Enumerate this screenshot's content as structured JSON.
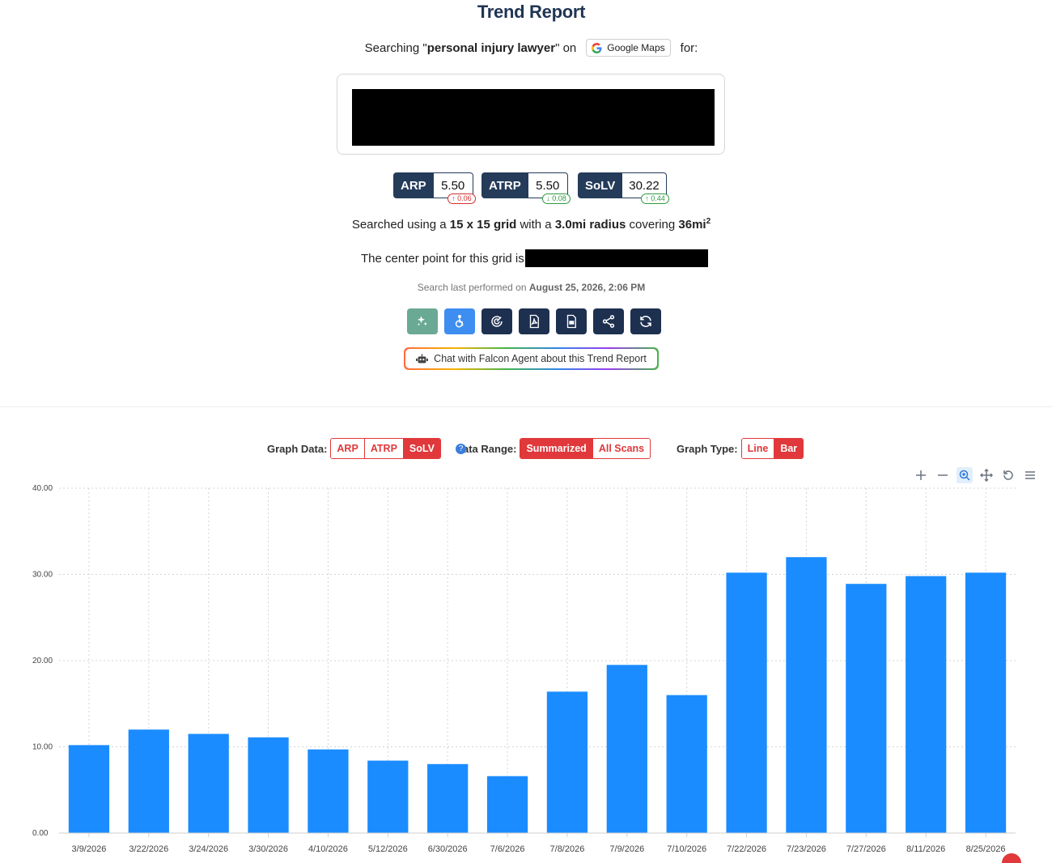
{
  "header": {
    "title": "Trend Report"
  },
  "search": {
    "prefix": "Searching \"",
    "keyword": "personal injury lawyer",
    "middle": "\" on",
    "platform": "Google Maps",
    "suffix": "for:"
  },
  "metrics": [
    {
      "label": "ARP",
      "value": "5.50",
      "delta": "0.06",
      "direction": "up",
      "color": "red"
    },
    {
      "label": "ATRP",
      "value": "5.50",
      "delta": "0.08",
      "direction": "down",
      "color": "green"
    },
    {
      "label": "SoLV",
      "value": "30.22",
      "delta": "0.44",
      "direction": "up",
      "color": "green"
    }
  ],
  "grid_info": {
    "part1": "Searched using a",
    "grid": "15 x 15 grid",
    "part2": "with a",
    "radius": "3.0mi radius",
    "part3": "covering",
    "area": "36mi",
    "area_sup": "2"
  },
  "center_point": {
    "label": "The center point for this grid is"
  },
  "last_performed": {
    "label": "Search last performed on",
    "date": "August 25, 2026, 2:06 PM"
  },
  "toolbar_icons": [
    "sparkle-icon",
    "accessibility-icon",
    "radar-icon",
    "pdf-icon",
    "csv-icon",
    "share-icon",
    "refresh-icon"
  ],
  "chat": {
    "label": "Chat with Falcon Agent about this Trend Report"
  },
  "graph_controls": {
    "data_label": "Graph Data:",
    "data_options": [
      "ARP",
      "ATRP",
      "SoLV"
    ],
    "data_selected": "SoLV",
    "range_label": "ata Range:",
    "range_options": [
      "Summarized",
      "All Scans"
    ],
    "range_selected": "Summarized",
    "type_label": "Graph Type:",
    "type_options": [
      "Line",
      "Bar"
    ],
    "type_selected": "Bar"
  },
  "colors": {
    "bar": "#1a8cff",
    "accent": "#e0383b",
    "navy": "#253b5a"
  },
  "chart_data": {
    "type": "bar",
    "categories": [
      "3/9/2026",
      "3/22/2026",
      "3/24/2026",
      "3/30/2026",
      "4/10/2026",
      "5/12/2026",
      "6/30/2026",
      "7/6/2026",
      "7/8/2026",
      "7/9/2026",
      "7/10/2026",
      "7/22/2026",
      "7/23/2026",
      "7/27/2026",
      "8/11/2026",
      "8/25/2026"
    ],
    "values": [
      10.2,
      12.0,
      11.5,
      11.1,
      9.7,
      8.4,
      8.0,
      6.6,
      16.4,
      19.5,
      16.0,
      30.2,
      32.0,
      28.9,
      29.8,
      30.2
    ],
    "ylim": [
      0,
      40
    ],
    "yticks": [
      "0.00",
      "10.00",
      "20.00",
      "30.00",
      "40.00"
    ],
    "grid": true
  }
}
